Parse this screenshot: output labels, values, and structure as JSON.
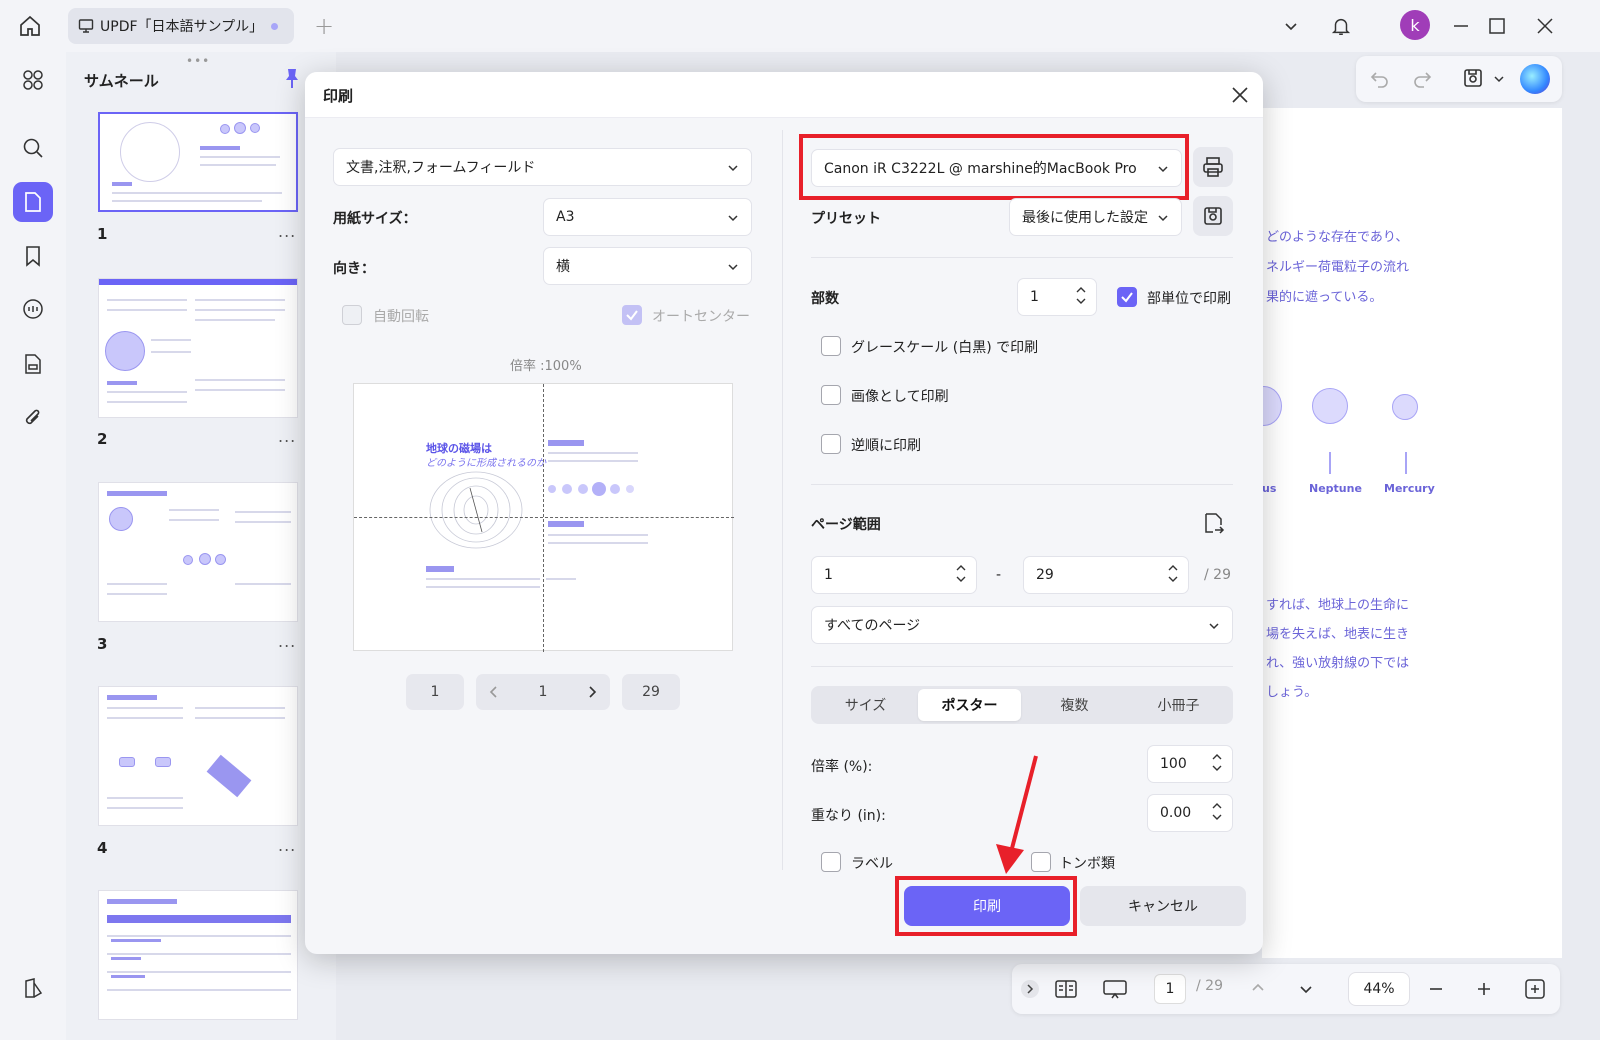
{
  "colors": {
    "accent": "#6b64f6",
    "highlight": "#e8202a",
    "avatar": "#a03db8"
  },
  "titlebar": {
    "tab_title": "UPDF「日本語サンプル」",
    "avatar_letter": "k"
  },
  "thumbnails": {
    "title": "サムネール",
    "pages": [
      {
        "number": "1",
        "more": "..."
      },
      {
        "number": "2",
        "more": "..."
      },
      {
        "number": "3",
        "more": "..."
      },
      {
        "number": "4",
        "more": "..."
      }
    ]
  },
  "background_doc": {
    "text_lines_top": [
      "どのような存在であり、",
      "ネルギー荷電粒子の流れ",
      "果的に遮っている。"
    ],
    "text_lines_bottom": [
      "すれば、地球上の生命に",
      "場を失えば、地表に生き",
      "れ、強い放射線の下では",
      "しょう。"
    ],
    "planets": [
      "us",
      "Neptune",
      "Mercury"
    ],
    "bottom_bar": {
      "page": "1",
      "total": "/ 29",
      "zoom": "44%"
    }
  },
  "dialog": {
    "title": "印刷",
    "content_select": "文書,注釈,フォームフィールド",
    "paper_size_label": "用紙サイズ：",
    "paper_size_value": "A3",
    "orientation_label": "向き：",
    "orientation_value": "横",
    "auto_rotate_label": "自動回転",
    "auto_center_label": "オートセンター",
    "scale_text": "倍率 :100%",
    "preview": {
      "title_1": "地球の磁場は",
      "title_2": "どのように形成されるのか"
    },
    "nav": {
      "first": "1",
      "current": "1",
      "last": "29"
    },
    "printer": "Canon iR C3222L @ marshine的MacBook Pro",
    "preset_label": "プリセット",
    "preset_value": "最後に使用した設定",
    "copies_label": "部数",
    "copies_value": "1",
    "collate_label": "部単位で印刷",
    "grayscale_label": "グレースケール (白黒) で印刷",
    "as_image_label": "画像として印刷",
    "reverse_label": "逆順に印刷",
    "page_range_label": "ページ範囲",
    "range_from": "1",
    "range_dash": "-",
    "range_to": "29",
    "range_total": "/ 29",
    "range_select": "すべてのページ",
    "tabs": [
      "サイズ",
      "ポスター",
      "複数",
      "小冊子"
    ],
    "active_tab": "ポスター",
    "scale_label": "倍率 (%):",
    "scale_value": "100",
    "overlap_label": "重なり (in):",
    "overlap_value": "0.00",
    "label_checkbox": "ラベル",
    "crop_marks_checkbox": "トンボ類",
    "print_button": "印刷",
    "cancel_button": "キャンセル"
  }
}
